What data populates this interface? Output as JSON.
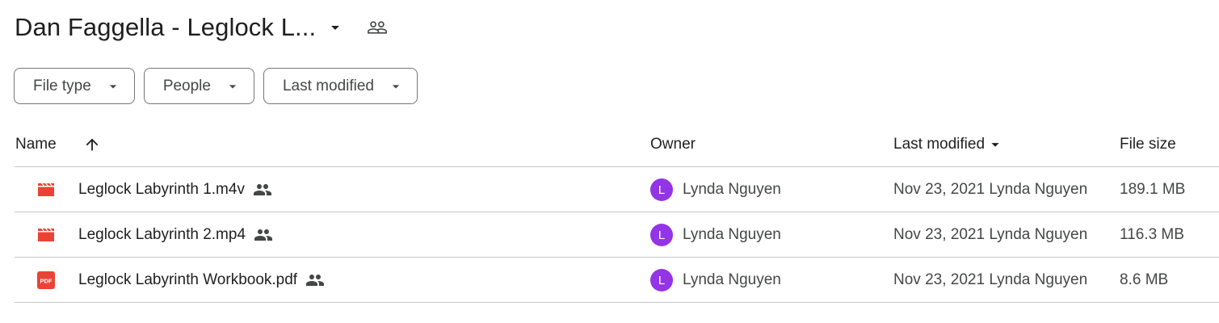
{
  "header": {
    "title": "Dan Faggella - Leglock L...",
    "caret_icon": "arrow-drop-down-icon",
    "shared_icon": "people-icon"
  },
  "filters": [
    {
      "label": "File type"
    },
    {
      "label": "People"
    },
    {
      "label": "Last modified"
    }
  ],
  "columns": {
    "name": "Name",
    "name_sort_icon": "arrow-upward-icon",
    "owner": "Owner",
    "last_modified": "Last modified",
    "last_modified_sort_icon": "arrow-drop-down-icon",
    "file_size": "File size"
  },
  "files": [
    {
      "name": "Leglock Labyrinth 1.m4v",
      "type_icon": "video-icon",
      "owner_initial": "L",
      "owner": "Lynda Nguyen",
      "modified": "Nov 23, 2021",
      "modified_by": "Lynda Nguyen",
      "size": "189.1 MB"
    },
    {
      "name": "Leglock Labyrinth 2.mp4",
      "type_icon": "video-icon",
      "owner_initial": "L",
      "owner": "Lynda Nguyen",
      "modified": "Nov 23, 2021",
      "modified_by": "Lynda Nguyen",
      "size": "116.3 MB"
    },
    {
      "name": "Leglock Labyrinth Workbook.pdf",
      "type_icon": "pdf-icon",
      "pdf_label": "PDF",
      "owner_initial": "L",
      "owner": "Lynda Nguyen",
      "modified": "Nov 23, 2021",
      "modified_by": "Lynda Nguyen",
      "size": "8.6 MB"
    }
  ],
  "colors": {
    "video_icon": "#ea4335",
    "pdf_icon": "#ea4335",
    "avatar_bg": "#9334e6",
    "divider": "#c7c7c7",
    "chip_border": "#747775"
  }
}
